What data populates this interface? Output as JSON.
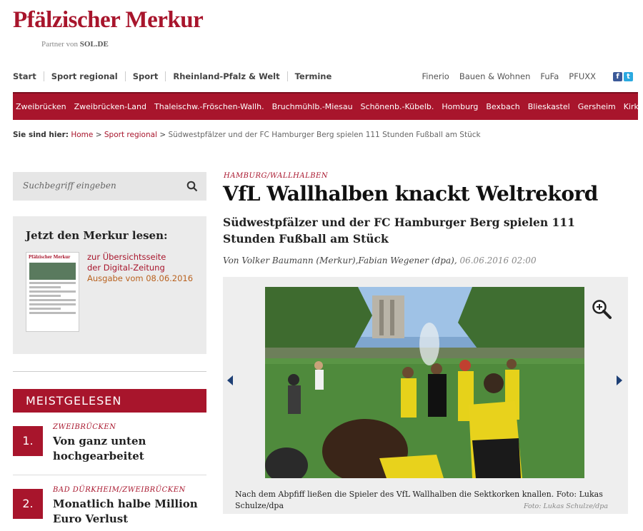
{
  "logo": {
    "text": "Pfälzischer Merkur"
  },
  "partner": {
    "prefix": "Partner von",
    "brand": "SOL.DE"
  },
  "nav": {
    "main": [
      "Start",
      "Sport regional",
      "Sport",
      "Rheinland-Pfalz & Welt",
      "Termine"
    ],
    "secondary": [
      "Finerio",
      "Bauen & Wohnen",
      "FuFa",
      "PFUXX"
    ]
  },
  "regions": [
    "Zweibrücken",
    "Zweibrücken-Land",
    "Thaleischw.-Fröschen-Wallh.",
    "Bruchmühlb.-Miesau",
    "Schönenb.-Kübelb.",
    "Homburg",
    "Bexbach",
    "Blieskastel",
    "Gersheim",
    "Kirkel"
  ],
  "breadcrumb": {
    "label": "Sie sind hier:",
    "home": "Home",
    "section": "Sport regional",
    "current": "Südwestpfälzer und der FC Hamburger Berg spielen 111 Stunden Fußball am Stück"
  },
  "search": {
    "placeholder": "Suchbegriff eingeben"
  },
  "epaper": {
    "title": "Jetzt den Merkur lesen:",
    "thumb_masthead": "Pfälzischer Merkur",
    "link1": "zur Übersichtsseite",
    "link2": "der Digital-Zeitung",
    "issue": "Ausgabe vom 08.06.2016"
  },
  "meistgelesen": {
    "title": "MEISTGELESEN",
    "items": [
      {
        "num": "1.",
        "category": "ZWEIBRÜCKEN",
        "title": "Von ganz unten hochgearbeitet"
      },
      {
        "num": "2.",
        "category": "BAD DÜRKHEIM/ZWEIBRÜCKEN",
        "title": "Monatlich halbe Million Euro Verlust"
      }
    ]
  },
  "article": {
    "kicker": "HAMBURG/WALLHALBEN",
    "headline": "VfL Wallhalben knackt Weltrekord",
    "subhead": "Südwestpfälzer und der FC Hamburger Berg spielen 111 Stunden Fußball am Stück",
    "byline": "Von Volker Baumann (Merkur),Fabian Wegener (dpa),",
    "date": "06.06.2016 02:00",
    "caption": "Nach dem Abpfiff ließen die Spieler des VfL Wallhalben die Sektkorken knallen. Foto: Lukas Schulze/dpa",
    "credit": "Foto: Lukas Schulze/dpa"
  },
  "colors": {
    "brand": "#a8152c",
    "arrow": "#1d3f75"
  }
}
